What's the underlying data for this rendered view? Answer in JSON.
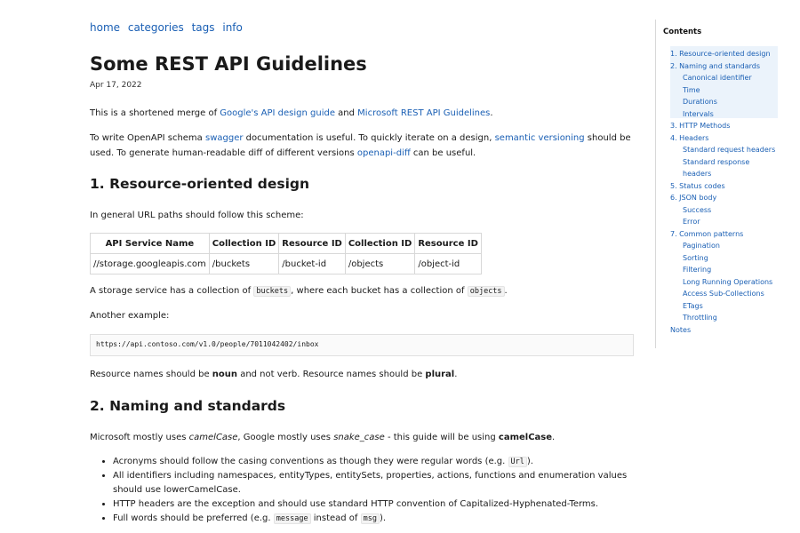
{
  "nav": [
    "home",
    "categories",
    "tags",
    "info"
  ],
  "page_title": "Some REST API Guidelines",
  "date": "Apr 17, 2022",
  "intro": {
    "a": "This is a shortened merge of ",
    "link1": "Google's API design guide",
    "b": " and ",
    "link2": "Microsoft REST API Guidelines",
    "c": "."
  },
  "tools": {
    "a": "To write OpenAPI schema ",
    "link1": "swagger",
    "b": " documentation is useful. To quickly iterate on a design, ",
    "link2": "semantic versioning",
    "c": " should be used. To generate human-readable diff of different versions ",
    "link3": "openapi-diff",
    "d": " can be useful."
  },
  "section1": {
    "heading": "1. Resource-oriented design",
    "scheme_text": "In general URL paths should follow this scheme:",
    "table": {
      "headers": [
        "API Service Name",
        "Collection ID",
        "Resource ID",
        "Collection ID",
        "Resource ID"
      ],
      "rows": [
        [
          "//storage.googleapis.com",
          "/buckets",
          "/bucket-id",
          "/objects",
          "/object-id"
        ]
      ]
    },
    "storage": {
      "a": "A storage service has a collection of ",
      "code1": "buckets",
      "b": ", where each bucket has a collection of ",
      "code2": "objects",
      "c": "."
    },
    "another": "Another example:",
    "example_url": "https://api.contoso.com/v1.0/people/7011042402/inbox",
    "names": {
      "a": "Resource names should be ",
      "b1": "noun",
      "b": " and not verb. Resource names should be ",
      "b2": "plural",
      "c": "."
    }
  },
  "section2": {
    "heading": "2. Naming and standards",
    "case": {
      "a": "Microsoft mostly uses ",
      "i1": "camelCase",
      "b": ", Google mostly uses ",
      "i2": "snake_case",
      "c": " - this guide will be using ",
      "b1": "camelCase",
      "d": "."
    },
    "bullets": {
      "b1": {
        "a": "Acronyms should follow the casing conventions as though they were regular words (e.g. ",
        "code": "Url",
        "b": ")."
      },
      "b2": "All identifiers including namespaces, entityTypes, entitySets, properties, actions, functions and enumeration values should use lowerCamelCase.",
      "b3": "HTTP headers are the exception and should use standard HTTP convention of Capitalized-Hyphenated-Terms.",
      "b4": {
        "a": "Full words should be preferred (e.g. ",
        "code1": "message",
        "b": " instead of ",
        "code2": "msg",
        "c": ")."
      }
    }
  },
  "toc": {
    "title": "Contents",
    "items": [
      {
        "label": "1. Resource-oriented design",
        "level": 0
      },
      {
        "label": "2. Naming and standards",
        "level": 0
      },
      {
        "label": "Canonical identifier",
        "level": 1
      },
      {
        "label": "Time",
        "level": 1
      },
      {
        "label": "Durations",
        "level": 1
      },
      {
        "label": "Intervals",
        "level": 1
      },
      {
        "label": "3. HTTP Methods",
        "level": 0
      },
      {
        "label": "4. Headers",
        "level": 0
      },
      {
        "label": "Standard request headers",
        "level": 1
      },
      {
        "label": "Standard response",
        "level": 1
      },
      {
        "label": "headers",
        "level": 1
      },
      {
        "label": "5. Status codes",
        "level": 0
      },
      {
        "label": "6. JSON body",
        "level": 0
      },
      {
        "label": "Success",
        "level": 1
      },
      {
        "label": "Error",
        "level": 1
      },
      {
        "label": "7. Common patterns",
        "level": 0
      },
      {
        "label": "Pagination",
        "level": 1
      },
      {
        "label": "Sorting",
        "level": 1
      },
      {
        "label": "Filtering",
        "level": 1
      },
      {
        "label": "Long Running Operations",
        "level": 1
      },
      {
        "label": "Access Sub-Collections",
        "level": 1
      },
      {
        "label": "ETags",
        "level": 1
      },
      {
        "label": "Throttling",
        "level": 1
      },
      {
        "label": "Notes",
        "level": 0
      }
    ]
  },
  "colors": {
    "link": "#1a5fb4",
    "toc_highlight": "#ebf3fb",
    "text": "#1a1a1a"
  }
}
